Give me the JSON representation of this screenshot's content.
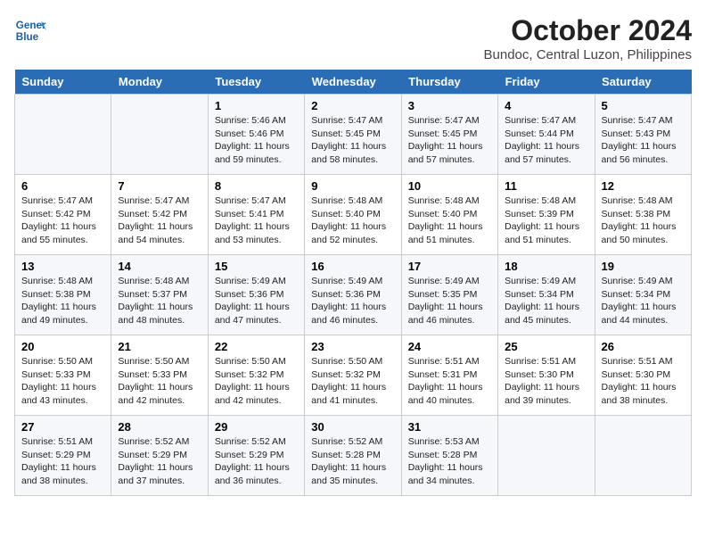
{
  "header": {
    "logo_line1": "General",
    "logo_line2": "Blue",
    "month": "October 2024",
    "location": "Bundoc, Central Luzon, Philippines"
  },
  "weekdays": [
    "Sunday",
    "Monday",
    "Tuesday",
    "Wednesday",
    "Thursday",
    "Friday",
    "Saturday"
  ],
  "weeks": [
    [
      {
        "day": "",
        "sunrise": "",
        "sunset": "",
        "daylight": ""
      },
      {
        "day": "",
        "sunrise": "",
        "sunset": "",
        "daylight": ""
      },
      {
        "day": "1",
        "sunrise": "Sunrise: 5:46 AM",
        "sunset": "Sunset: 5:46 PM",
        "daylight": "Daylight: 11 hours and 59 minutes."
      },
      {
        "day": "2",
        "sunrise": "Sunrise: 5:47 AM",
        "sunset": "Sunset: 5:45 PM",
        "daylight": "Daylight: 11 hours and 58 minutes."
      },
      {
        "day": "3",
        "sunrise": "Sunrise: 5:47 AM",
        "sunset": "Sunset: 5:45 PM",
        "daylight": "Daylight: 11 hours and 57 minutes."
      },
      {
        "day": "4",
        "sunrise": "Sunrise: 5:47 AM",
        "sunset": "Sunset: 5:44 PM",
        "daylight": "Daylight: 11 hours and 57 minutes."
      },
      {
        "day": "5",
        "sunrise": "Sunrise: 5:47 AM",
        "sunset": "Sunset: 5:43 PM",
        "daylight": "Daylight: 11 hours and 56 minutes."
      }
    ],
    [
      {
        "day": "6",
        "sunrise": "Sunrise: 5:47 AM",
        "sunset": "Sunset: 5:42 PM",
        "daylight": "Daylight: 11 hours and 55 minutes."
      },
      {
        "day": "7",
        "sunrise": "Sunrise: 5:47 AM",
        "sunset": "Sunset: 5:42 PM",
        "daylight": "Daylight: 11 hours and 54 minutes."
      },
      {
        "day": "8",
        "sunrise": "Sunrise: 5:47 AM",
        "sunset": "Sunset: 5:41 PM",
        "daylight": "Daylight: 11 hours and 53 minutes."
      },
      {
        "day": "9",
        "sunrise": "Sunrise: 5:48 AM",
        "sunset": "Sunset: 5:40 PM",
        "daylight": "Daylight: 11 hours and 52 minutes."
      },
      {
        "day": "10",
        "sunrise": "Sunrise: 5:48 AM",
        "sunset": "Sunset: 5:40 PM",
        "daylight": "Daylight: 11 hours and 51 minutes."
      },
      {
        "day": "11",
        "sunrise": "Sunrise: 5:48 AM",
        "sunset": "Sunset: 5:39 PM",
        "daylight": "Daylight: 11 hours and 51 minutes."
      },
      {
        "day": "12",
        "sunrise": "Sunrise: 5:48 AM",
        "sunset": "Sunset: 5:38 PM",
        "daylight": "Daylight: 11 hours and 50 minutes."
      }
    ],
    [
      {
        "day": "13",
        "sunrise": "Sunrise: 5:48 AM",
        "sunset": "Sunset: 5:38 PM",
        "daylight": "Daylight: 11 hours and 49 minutes."
      },
      {
        "day": "14",
        "sunrise": "Sunrise: 5:48 AM",
        "sunset": "Sunset: 5:37 PM",
        "daylight": "Daylight: 11 hours and 48 minutes."
      },
      {
        "day": "15",
        "sunrise": "Sunrise: 5:49 AM",
        "sunset": "Sunset: 5:36 PM",
        "daylight": "Daylight: 11 hours and 47 minutes."
      },
      {
        "day": "16",
        "sunrise": "Sunrise: 5:49 AM",
        "sunset": "Sunset: 5:36 PM",
        "daylight": "Daylight: 11 hours and 46 minutes."
      },
      {
        "day": "17",
        "sunrise": "Sunrise: 5:49 AM",
        "sunset": "Sunset: 5:35 PM",
        "daylight": "Daylight: 11 hours and 46 minutes."
      },
      {
        "day": "18",
        "sunrise": "Sunrise: 5:49 AM",
        "sunset": "Sunset: 5:34 PM",
        "daylight": "Daylight: 11 hours and 45 minutes."
      },
      {
        "day": "19",
        "sunrise": "Sunrise: 5:49 AM",
        "sunset": "Sunset: 5:34 PM",
        "daylight": "Daylight: 11 hours and 44 minutes."
      }
    ],
    [
      {
        "day": "20",
        "sunrise": "Sunrise: 5:50 AM",
        "sunset": "Sunset: 5:33 PM",
        "daylight": "Daylight: 11 hours and 43 minutes."
      },
      {
        "day": "21",
        "sunrise": "Sunrise: 5:50 AM",
        "sunset": "Sunset: 5:33 PM",
        "daylight": "Daylight: 11 hours and 42 minutes."
      },
      {
        "day": "22",
        "sunrise": "Sunrise: 5:50 AM",
        "sunset": "Sunset: 5:32 PM",
        "daylight": "Daylight: 11 hours and 42 minutes."
      },
      {
        "day": "23",
        "sunrise": "Sunrise: 5:50 AM",
        "sunset": "Sunset: 5:32 PM",
        "daylight": "Daylight: 11 hours and 41 minutes."
      },
      {
        "day": "24",
        "sunrise": "Sunrise: 5:51 AM",
        "sunset": "Sunset: 5:31 PM",
        "daylight": "Daylight: 11 hours and 40 minutes."
      },
      {
        "day": "25",
        "sunrise": "Sunrise: 5:51 AM",
        "sunset": "Sunset: 5:30 PM",
        "daylight": "Daylight: 11 hours and 39 minutes."
      },
      {
        "day": "26",
        "sunrise": "Sunrise: 5:51 AM",
        "sunset": "Sunset: 5:30 PM",
        "daylight": "Daylight: 11 hours and 38 minutes."
      }
    ],
    [
      {
        "day": "27",
        "sunrise": "Sunrise: 5:51 AM",
        "sunset": "Sunset: 5:29 PM",
        "daylight": "Daylight: 11 hours and 38 minutes."
      },
      {
        "day": "28",
        "sunrise": "Sunrise: 5:52 AM",
        "sunset": "Sunset: 5:29 PM",
        "daylight": "Daylight: 11 hours and 37 minutes."
      },
      {
        "day": "29",
        "sunrise": "Sunrise: 5:52 AM",
        "sunset": "Sunset: 5:29 PM",
        "daylight": "Daylight: 11 hours and 36 minutes."
      },
      {
        "day": "30",
        "sunrise": "Sunrise: 5:52 AM",
        "sunset": "Sunset: 5:28 PM",
        "daylight": "Daylight: 11 hours and 35 minutes."
      },
      {
        "day": "31",
        "sunrise": "Sunrise: 5:53 AM",
        "sunset": "Sunset: 5:28 PM",
        "daylight": "Daylight: 11 hours and 34 minutes."
      },
      {
        "day": "",
        "sunrise": "",
        "sunset": "",
        "daylight": ""
      },
      {
        "day": "",
        "sunrise": "",
        "sunset": "",
        "daylight": ""
      }
    ]
  ]
}
